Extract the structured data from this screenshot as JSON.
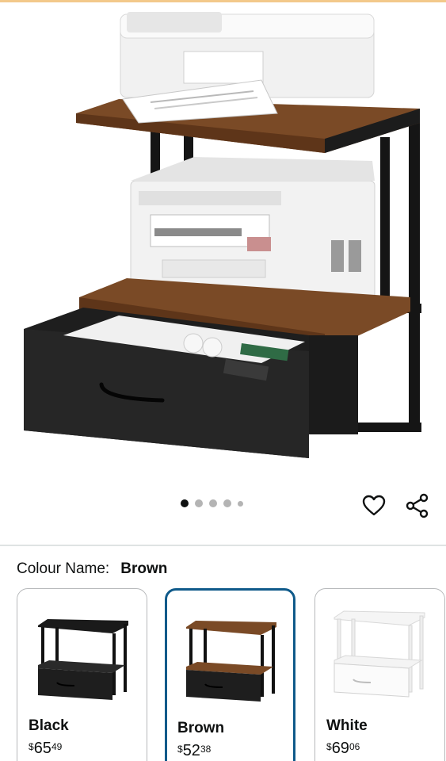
{
  "product_image": {
    "alt": "Printer stand with drawer",
    "carousel_dots": 5,
    "active_dot": 0
  },
  "actions": {
    "favorite_icon": "heart-icon",
    "share_icon": "share-icon"
  },
  "colour": {
    "label": "Colour Name:",
    "selected": "Brown"
  },
  "variants": [
    {
      "name": "Black",
      "currency": "$",
      "price_whole": "65",
      "price_fraction": "49",
      "selected": false
    },
    {
      "name": "Brown",
      "currency": "$",
      "price_whole": "52",
      "price_fraction": "38",
      "selected": true
    },
    {
      "name": "White",
      "currency": "$",
      "price_whole": "69",
      "price_fraction": "06",
      "selected": false
    }
  ],
  "colors": {
    "selected_border": "#0f5a8a",
    "wood": "#7a4a26",
    "frame": "#151515"
  }
}
